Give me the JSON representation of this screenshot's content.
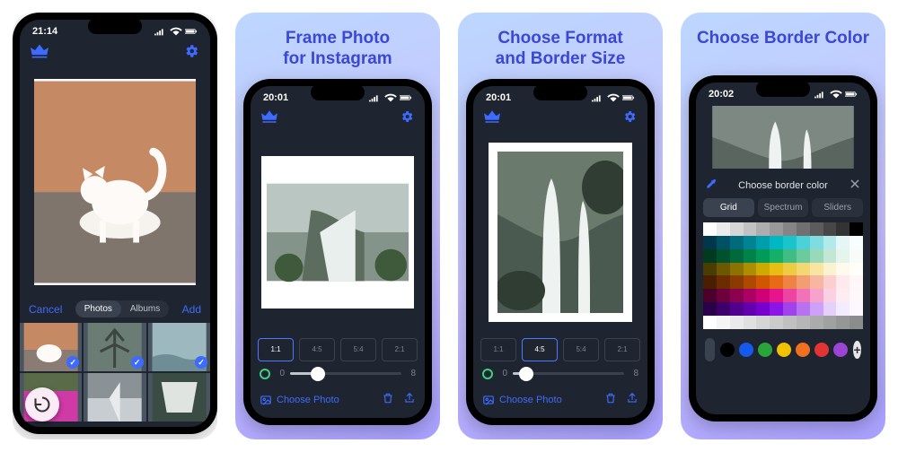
{
  "panels": [
    {
      "title": ""
    },
    {
      "title": "Frame Photo\nfor Instagram"
    },
    {
      "title": "Choose Format\nand Border Size"
    },
    {
      "title": "Choose Border Color"
    }
  ],
  "phones": {
    "p1": {
      "time": "21:14",
      "picker": {
        "cancel": "Cancel",
        "add": "Add",
        "tabs": [
          "Photos",
          "Albums"
        ],
        "active_tab": 0
      }
    },
    "p2": {
      "time": "20:01",
      "slider": {
        "min": 0,
        "max": 8,
        "value": 2
      },
      "ratios": [
        "1:1",
        "4:5",
        "5:4",
        "2:1"
      ],
      "active_ratio": 0,
      "choose_label": "Choose Photo"
    },
    "p3": {
      "time": "20:01",
      "slider": {
        "min": 0,
        "max": 8,
        "value": 1
      },
      "ratios": [
        "1:1",
        "4:5",
        "5:4",
        "2:1"
      ],
      "active_ratio": 1,
      "choose_label": "Choose Photo"
    },
    "p4": {
      "time": "20:02",
      "color_picker": {
        "title": "Choose border color",
        "tabs": [
          "Grid",
          "Spectrum",
          "Sliders"
        ],
        "active_tab": 0,
        "preset_dots": [
          "#000000",
          "#1559ed",
          "#29a53a",
          "#f2c200",
          "#f07020",
          "#e23434",
          "#9b44d6"
        ]
      }
    }
  },
  "grid_colors": [
    "#ffffff",
    "#ebebeb",
    "#d6d6d6",
    "#c2c2c2",
    "#adadad",
    "#999999",
    "#858585",
    "#707070",
    "#5c5c5c",
    "#474747",
    "#333333",
    "#000000",
    "#00374a",
    "#005163",
    "#006b7c",
    "#008494",
    "#009eac",
    "#00b8c4",
    "#1ac4cd",
    "#4cd1d8",
    "#7fdde2",
    "#b2eaec",
    "#e5f6f7",
    "#f8fdfd",
    "#003a1f",
    "#00522e",
    "#006a3c",
    "#00834a",
    "#009b58",
    "#14af69",
    "#3fbd84",
    "#6bcb9f",
    "#98d9ba",
    "#c4e7d5",
    "#e5f4ed",
    "#f7fcf9",
    "#4a3d00",
    "#6b5800",
    "#8c7300",
    "#ad8e00",
    "#cea900",
    "#e7be14",
    "#edcb43",
    "#f2d872",
    "#f7e5a1",
    "#fbf2d0",
    "#fefaec",
    "#fffef8",
    "#4a1f00",
    "#6b2d00",
    "#8c3b00",
    "#ad4900",
    "#ce5700",
    "#e76b14",
    "#ed8443",
    "#f29d72",
    "#f7b6a1",
    "#fbcfd0",
    "#fee9ec",
    "#fff6f8",
    "#4a002a",
    "#6b003d",
    "#8c0050",
    "#ad0063",
    "#ce0076",
    "#e7148b",
    "#ed43a1",
    "#f272b7",
    "#f7a1cd",
    "#fbd0e3",
    "#feecf3",
    "#fff8fb",
    "#2a004a",
    "#3d006b",
    "#50008c",
    "#6300ad",
    "#7600ce",
    "#8b14e7",
    "#a143ed",
    "#b772f2",
    "#cda1f7",
    "#e3d0fb",
    "#f3ecfe",
    "#fbf8ff",
    "#ffffff",
    "#f5f5f5",
    "#eaeaea",
    "#e0e0e0",
    "#d5d5d5",
    "#cbcbcb",
    "#c0c0c0",
    "#b6b6b6",
    "#ababab",
    "#a1a1a1",
    "#969696",
    "#8c8c8c"
  ]
}
